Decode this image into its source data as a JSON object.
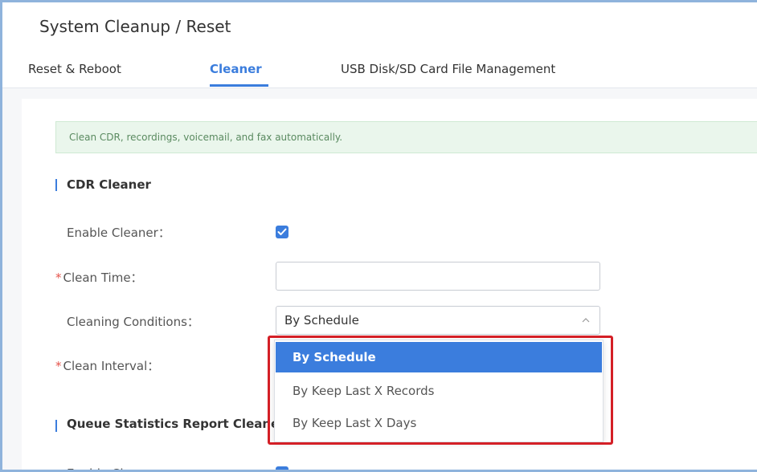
{
  "header": {
    "title": "System Cleanup / Reset"
  },
  "tabs": [
    {
      "label": "Reset & Reboot",
      "active": false
    },
    {
      "label": "Cleaner",
      "active": true
    },
    {
      "label": "USB Disk/SD Card File Management",
      "active": false
    }
  ],
  "banner": {
    "text": "Clean CDR, recordings, voicemail, and fax automatically."
  },
  "cdr_cleaner": {
    "section_title": "CDR Cleaner",
    "enable_label": "Enable Cleaner：",
    "enable_checked": true,
    "clean_time_label": "Clean Time：",
    "clean_time_value": "",
    "cleaning_conditions_label": "Cleaning Conditions：",
    "cleaning_conditions_value": "By Schedule",
    "clean_interval_label": "Clean Interval："
  },
  "dropdown": {
    "options": [
      {
        "label": "By Schedule",
        "selected": true
      },
      {
        "label": "By Keep Last X Records",
        "selected": false
      },
      {
        "label": "By Keep Last X Days",
        "selected": false
      }
    ]
  },
  "queue_section": {
    "section_title": "Queue Statistics Report Cleaner",
    "enable_label": "Enable Cleaner："
  },
  "colors": {
    "accent": "#3b7ddd",
    "required": "#e5534b",
    "highlight": "#d41f26",
    "banner_bg": "#eaf6ec"
  },
  "icons": {
    "checkbox": "check-icon",
    "select_arrow": "chevron-up-icon"
  }
}
